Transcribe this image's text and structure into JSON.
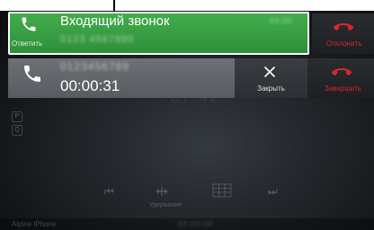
{
  "incoming_call": {
    "title": "Входящий звонок",
    "caller_number_blurred": "0123 4567890",
    "time_blurred": "00:00",
    "answer_label": "Ответить",
    "decline_label": "Отклонить"
  },
  "active_call": {
    "caller_blurred": "0123456789",
    "duration": "00:00:31",
    "close_label": "Закрыть",
    "end_label": "Завершить"
  },
  "controls": {
    "hold_label": "Удержание"
  },
  "status_bar": {
    "device_label": "Alpine iPhone",
    "center_blurred": "00:00:00"
  },
  "colors": {
    "answer_green": "#3ba045",
    "decline_red": "#d8262d",
    "accent_white": "#ffffff"
  },
  "icons": {
    "answer": "phone-icon",
    "decline": "hang-up-icon",
    "close": "close-x-icon",
    "end": "hang-up-icon",
    "previous": "skip-previous-icon",
    "next": "skip-next-icon",
    "hold": "hold-icon",
    "keypad": "keypad-icon"
  }
}
